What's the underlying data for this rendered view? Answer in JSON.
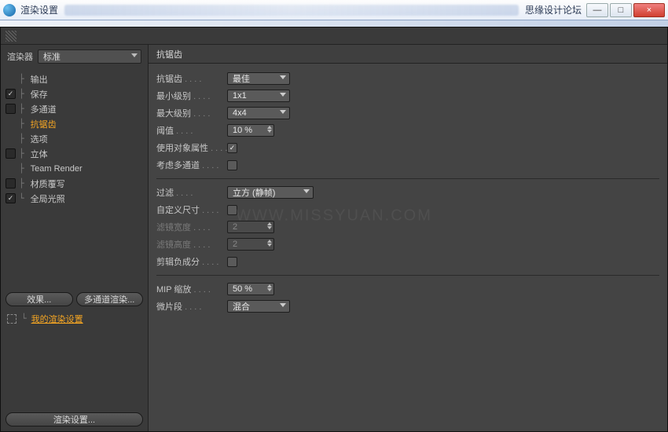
{
  "titlebar": {
    "title": "渲染设置",
    "brand": "思缘设计论坛"
  },
  "winbtns": {
    "min": "—",
    "max": "□",
    "close": "×"
  },
  "watermark": "WWW.MISSYUAN.COM",
  "sidebar": {
    "renderer_label": "渲染器",
    "renderer_value": "标准",
    "items": [
      {
        "label": "输出",
        "check": "none",
        "sel": false
      },
      {
        "label": "保存",
        "check": "on",
        "sel": false
      },
      {
        "label": "多通道",
        "check": "off",
        "sel": false
      },
      {
        "label": "抗锯齿",
        "check": "none",
        "sel": true
      },
      {
        "label": "选项",
        "check": "none",
        "sel": false
      },
      {
        "label": "立体",
        "check": "off",
        "sel": false
      },
      {
        "label": "Team Render",
        "check": "none",
        "sel": false
      },
      {
        "label": "材质覆写",
        "check": "off",
        "sel": false
      },
      {
        "label": "全局光照",
        "check": "on",
        "sel": false
      }
    ],
    "effects_btn": "效果...",
    "multipass_btn": "多通道渲染...",
    "preset": "我的渲染设置",
    "bottom_btn": "渲染设置..."
  },
  "panel": {
    "title": "抗锯齿",
    "rows": [
      {
        "t": "dropdown",
        "label": "抗锯齿",
        "value": "最佳"
      },
      {
        "t": "dropdown",
        "label": "最小级别",
        "value": "1x1"
      },
      {
        "t": "dropdown",
        "label": "最大级别",
        "value": "4x4"
      },
      {
        "t": "spin",
        "label": "阈值",
        "value": "10 %"
      },
      {
        "t": "check",
        "label": "使用对象属性",
        "value": true
      },
      {
        "t": "check",
        "label": "考虑多通道",
        "value": false
      },
      {
        "t": "sep"
      },
      {
        "t": "dropdown",
        "label": "过滤",
        "value": "立方 (静帧)",
        "wide": true
      },
      {
        "t": "check",
        "label": "自定义尺寸",
        "value": false
      },
      {
        "t": "spin",
        "label": "滤镜宽度",
        "value": "2",
        "dis": true
      },
      {
        "t": "spin",
        "label": "滤镜高度",
        "value": "2",
        "dis": true
      },
      {
        "t": "check",
        "label": "剪辑负成分",
        "value": false
      },
      {
        "t": "sep"
      },
      {
        "t": "spin",
        "label": "MIP 缩放",
        "value": "50 %"
      },
      {
        "t": "dropdown",
        "label": "微片段",
        "value": "混合"
      }
    ]
  }
}
